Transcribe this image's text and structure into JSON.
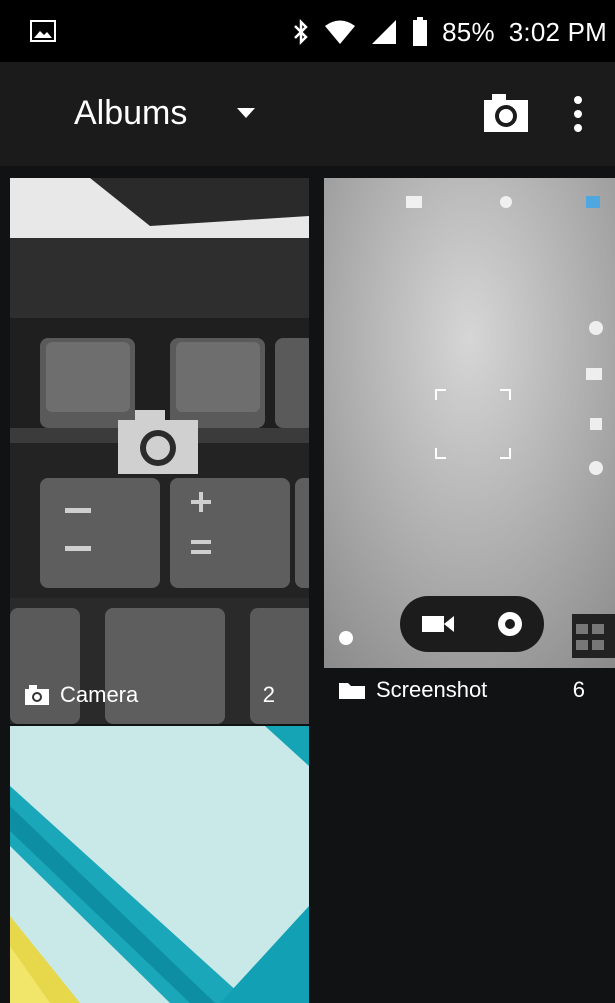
{
  "status_bar": {
    "battery": "85%",
    "time": "3:02 PM",
    "icons": [
      "gallery-notification-icon",
      "bluetooth-icon",
      "wifi-icon",
      "cell-signal-icon",
      "battery-icon"
    ]
  },
  "app_bar": {
    "title": "Albums",
    "actions": [
      "camera-icon",
      "overflow-menu-icon"
    ]
  },
  "albums": [
    {
      "name": "Camera",
      "count": "2",
      "icon": "camera-icon"
    },
    {
      "name": "Screenshot",
      "count": "6",
      "icon": "folder-icon"
    },
    {
      "name": "",
      "count": "",
      "icon": ""
    }
  ],
  "colors": {
    "background": "#111213",
    "status_bar": "#000000",
    "app_bar": "#1b1b1c"
  }
}
